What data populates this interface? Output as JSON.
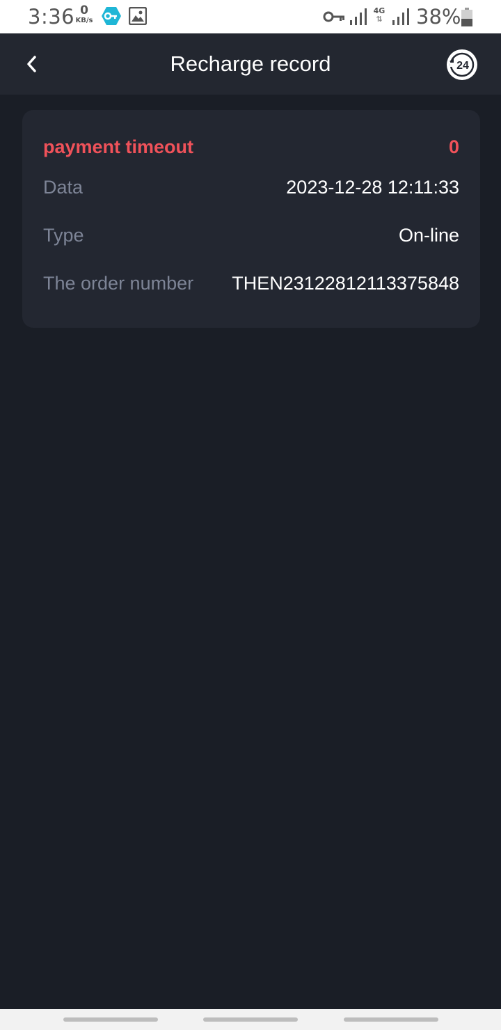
{
  "status_bar": {
    "time": "3:36",
    "net_speed_value": "0",
    "net_speed_unit": "KB/s",
    "network_type": "4G",
    "battery_percent": "38%",
    "icons": [
      "vpn-key-icon",
      "image-icon",
      "key-icon",
      "signal-icon",
      "signal-icon",
      "battery-icon"
    ]
  },
  "header": {
    "title": "Recharge record",
    "back_icon": "chevron-left-icon",
    "support_icon": "support-24-icon",
    "support_badge": "24"
  },
  "record": {
    "status": "payment timeout",
    "amount": "0",
    "rows": [
      {
        "label": "Data",
        "value": "2023-12-28 12:11:33"
      },
      {
        "label": "Type",
        "value": "On-line"
      },
      {
        "label": "The order number",
        "value": "THEN23122812113375848"
      }
    ]
  },
  "colors": {
    "background": "#1a1e26",
    "header": "#232730",
    "card": "#232731",
    "status_red": "#f0525a",
    "label_gray": "#7d8496",
    "value_white": "#ffffff"
  }
}
